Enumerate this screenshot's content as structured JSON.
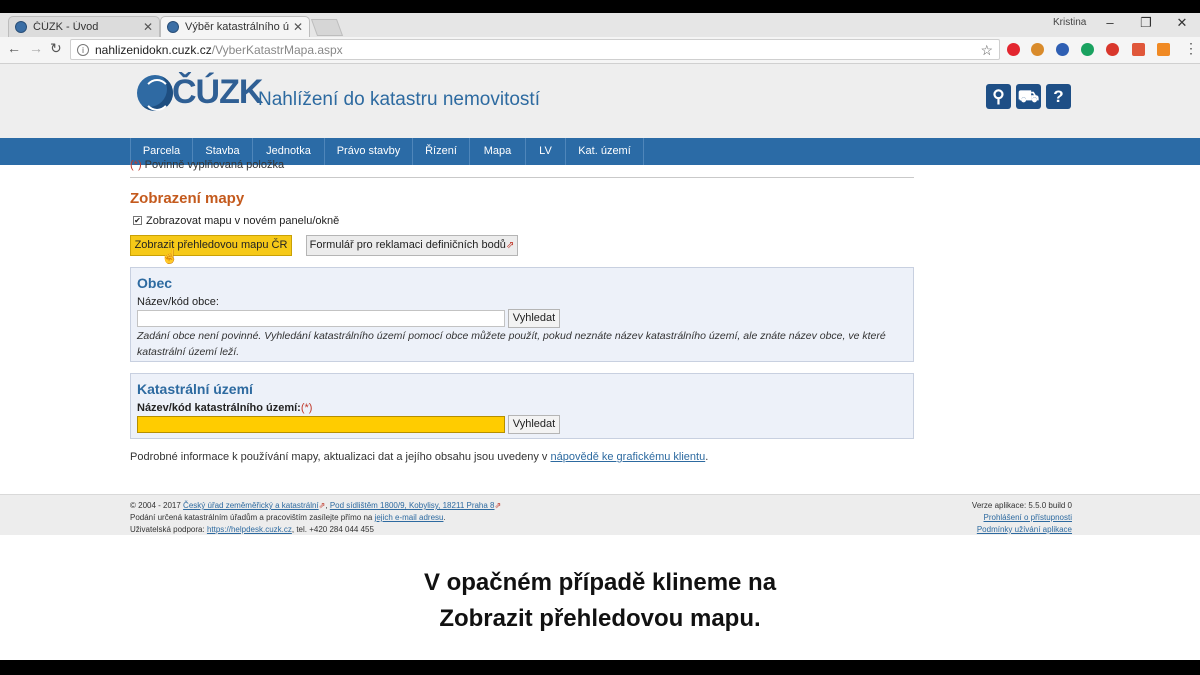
{
  "browser": {
    "tabs": [
      {
        "title": "ČÚZK - Úvod"
      },
      {
        "title": "Výběr katastrálního územ"
      }
    ],
    "window_user": "Kristina",
    "url_host": "nahlizenidokn.cuzk.cz",
    "url_path": "/VyberKatastrMapa.aspx"
  },
  "site": {
    "logo_text": "ČÚZK",
    "title": "Nahlížení do katastru nemovitostí",
    "icons": [
      "key-search-icon",
      "cart-icon",
      "help-icon"
    ]
  },
  "nav": {
    "items": [
      "Parcela",
      "Stavba",
      "Jednotka",
      "Právo stavby",
      "Řízení",
      "Mapa",
      "LV",
      "Kat. území"
    ]
  },
  "form": {
    "required_note_mark": "(*)",
    "required_note": "Povinně vyplňovaná položka",
    "section_title": "Zobrazení mapy",
    "checkbox_label": "Zobrazovat mapu v novém panelu/okně",
    "checkbox_checked": true,
    "btn_overview": "Zobrazit přehledovou mapu ČR",
    "btn_complaint": "Formulář pro reklamaci definičních bodů",
    "obec": {
      "title": "Obec",
      "label": "Název/kód obce:",
      "value": "",
      "search": "Vyhledat",
      "note": "Zadání obce není povinné. Vyhledání katastrálního území pomocí obce můžete použít, pokud neznáte název katastrálního území, ale znáte název obce, ve které katastrální území leží."
    },
    "ku": {
      "title": "Katastrální území",
      "label": "Název/kód katastrálního území:",
      "label_mark": "(*)",
      "value": "",
      "search": "Vyhledat"
    },
    "info_text": "Podrobné informace k používání mapy, aktualizaci dat a jejího obsahu jsou uvedeny v ",
    "info_link": "nápovědě ke grafickému klientu",
    "info_end": "."
  },
  "footer": {
    "copyright": "© 2004 - 2017 ",
    "org_link": "Český úřad zeměměřický a katastrální",
    "sep": ", ",
    "address_link": "Pod sídlištěm 1800/9, Kobylisy, 18211 Praha 8",
    "line2_text": "Podání určená katastrálním úřadům a pracovištím zasílejte přímo na ",
    "line2_link": "jejich e-mail adresu",
    "line2_end": ".",
    "support_text": "Uživatelská podpora: ",
    "support_link": "https://helpdesk.cuzk.cz",
    "support_phone": ", tel. +420 284 044 455",
    "version": "Verze aplikace: 5.5.0 build 0",
    "accessibility_link": "Prohlášení o přístupnosti",
    "terms_link": "Podmínky užívání aplikace"
  },
  "subtitles": {
    "line1": "V opačném případě klineme na",
    "line2": "Zobrazit přehledovou mapu."
  }
}
